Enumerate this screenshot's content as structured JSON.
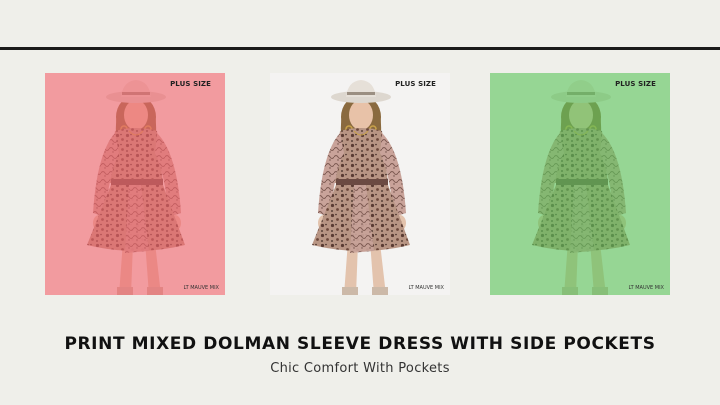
{
  "product": {
    "title": "PRINT MIXED DOLMAN SLEEVE DRESS WITH SIDE POCKETS",
    "subtitle": "Chic Comfort With Pockets"
  },
  "images": [
    {
      "badge": "PLUS SIZE",
      "color_label": "LT MAUVE MIX",
      "tint": "#f0646c",
      "tint_opacity": 0.62
    },
    {
      "badge": "PLUS SIZE",
      "color_label": "LT MAUVE MIX",
      "tint": "#ffffff",
      "tint_opacity": 0.0
    },
    {
      "badge": "PLUS SIZE",
      "color_label": "LT MAUVE MIX",
      "tint": "#5cc35a",
      "tint_opacity": 0.62
    }
  ]
}
